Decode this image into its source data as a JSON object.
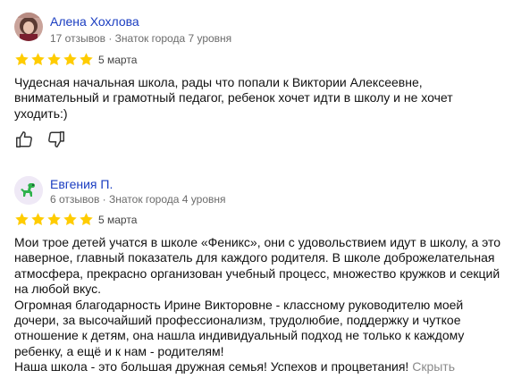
{
  "reviews": [
    {
      "author": "Алена Хохлова",
      "meta": "17 отзывов · Знаток города 7 уровня",
      "rating": 5,
      "date": "5 марта",
      "text": [
        "Чудесная начальная школа, рады что попали к Виктории Алексеевне, внимательный и грамотный педагог, ребенок хочет идти в школу и не хочет уходить:)"
      ]
    },
    {
      "author": "Евгения П.",
      "meta": "6 отзывов · Знаток города 4 уровня",
      "rating": 5,
      "date": "5 марта",
      "text": [
        "Мои трое детей учатся в школе «Феникс», они с удовольствием идут в школу, а это наверное, главный показатель для каждого родителя. В школе доброжелательная атмосфера, прекрасно организован учебный процесс, множество кружков и секций на любой вкус.",
        "Огромная благодарность Ирине Викторовне - классному руководителю моей дочери, за высочайший профессионализм, трудолюбие, поддержку и чуткое отношение к детям, она нашла индивидуальный подход не только к каждому ребенку, а ещё и к нам - родителям!",
        "Наша школа - это большая дружная семья! Успехов и процветания!"
      ],
      "hide_label": "Скрыть"
    }
  ],
  "colors": {
    "star": "#fc0",
    "author_link": "#1a3dc1"
  },
  "icons": {
    "like": "thumbs-up-icon",
    "dislike": "thumbs-down-icon",
    "avatar2": "dinosaur-icon"
  }
}
